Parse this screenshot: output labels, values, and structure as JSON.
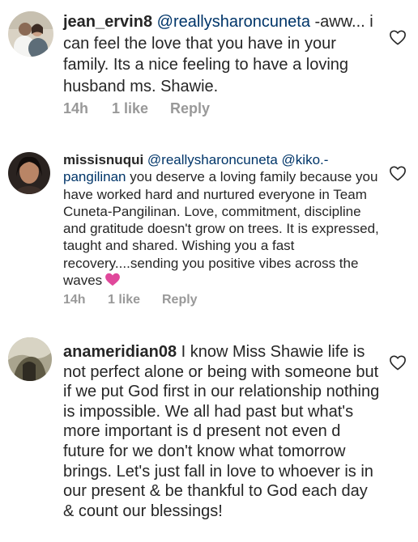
{
  "comments": [
    {
      "username": "jean_ervin8",
      "mention": "@reallysharoncuneta",
      "text": " -aww... i can feel the love that you have in your family. Its a nice feeling to have a loving husband ms. Shawie.",
      "time": "14h",
      "likes": "1 like",
      "reply": "Reply",
      "avatar_icon": "avatar-photo-couple",
      "like_icon": "heart-outline-icon"
    },
    {
      "username": "missisnuqui",
      "mention": "@reallysharoncuneta @kiko.-pangilinan",
      "text": " you deserve a loving family because you have worked hard and nurtured everyone in Team Cuneta-Pangilinan. Love, commitment, discipline and gratitude doesn't grow on trees. It is expressed, taught and shared. Wishing you a fast recovery....sending you positive vibes across the waves",
      "emoji": "pink-heart-emoji",
      "time": "14h",
      "likes": "1 like",
      "reply": "Reply",
      "avatar_icon": "avatar-photo-woman",
      "like_icon": "heart-outline-icon"
    },
    {
      "username": "anameridian08",
      "text": " I know Miss Shawie life is not perfect alone or being with someone but if we put God first in our relationship nothing is impossible. We all had past but what's more important is d present not even d future for we don't know what tomorrow brings. Let's just fall in love to whoever is in our present & be thankful to God each day & count our blessings!",
      "avatar_icon": "avatar-photo-landscape",
      "like_icon": "heart-outline-icon"
    }
  ],
  "colors": {
    "text": "#262626",
    "mention": "#003569",
    "meta": "#999999",
    "heart_emoji": "#e0489b"
  }
}
